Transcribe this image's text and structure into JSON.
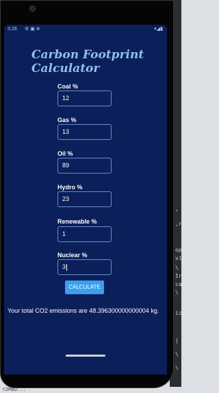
{
  "status_bar": {
    "time": "3:28",
    "left_icons": "⚙ ▣ ⊕",
    "right_icons": "▾◢▮"
  },
  "app": {
    "title": "Carbon Footprint Calculator",
    "fields": [
      {
        "label": "Coal %",
        "value": "12"
      },
      {
        "label": "Gas %",
        "value": "13"
      },
      {
        "label": "Oil %",
        "value": "89"
      },
      {
        "label": "Hydro %",
        "value": "23"
      },
      {
        "label": "Renewable %",
        "value": "1"
      },
      {
        "label": "Nuclear %",
        "value": "3"
      }
    ],
    "calculate_label": "CALCULATE",
    "result_text": "Your total CO2 emissions are 48.396300000000004 kg."
  },
  "colors": {
    "screen_bg": "#0b1f5a",
    "title": "#8fc0f0",
    "button": "#3aa0ec"
  },
  "background_ide": {
    "lines": [
      ",",
      ",r",
      "op",
      "vi",
      "\\",
      "Ir",
      "ca",
      "\\",
      "iz",
      "|",
      "\\",
      "\\"
    ],
    "bottom": "COMBD..."
  }
}
